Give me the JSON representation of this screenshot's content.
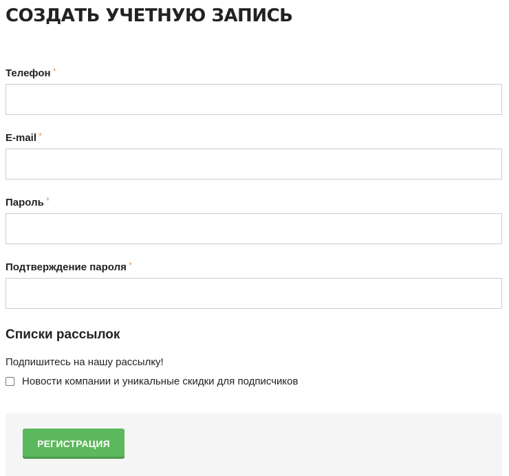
{
  "page": {
    "title": "СОЗДАТЬ УЧЕТНУЮ ЗАПИСЬ"
  },
  "form": {
    "required_marker": "*",
    "fields": [
      {
        "label": "Телефон",
        "value": ""
      },
      {
        "label": "E-mail",
        "value": ""
      },
      {
        "label": "Пароль",
        "value": ""
      },
      {
        "label": "Подтверждение пароля",
        "value": ""
      }
    ]
  },
  "newsletter": {
    "section_title": "Списки рассылок",
    "subscribe_text": "Подпишитесь на нашу рассылку!",
    "checkbox_label": "Новости компании и уникальные скидки для подписчиков",
    "checked": false
  },
  "actions": {
    "submit_label": "РЕГИСТРАЦИЯ"
  },
  "colors": {
    "required_marker": "#e0a36e",
    "submit_background": "#5cb85c",
    "actions_background": "#f5f5f5"
  }
}
